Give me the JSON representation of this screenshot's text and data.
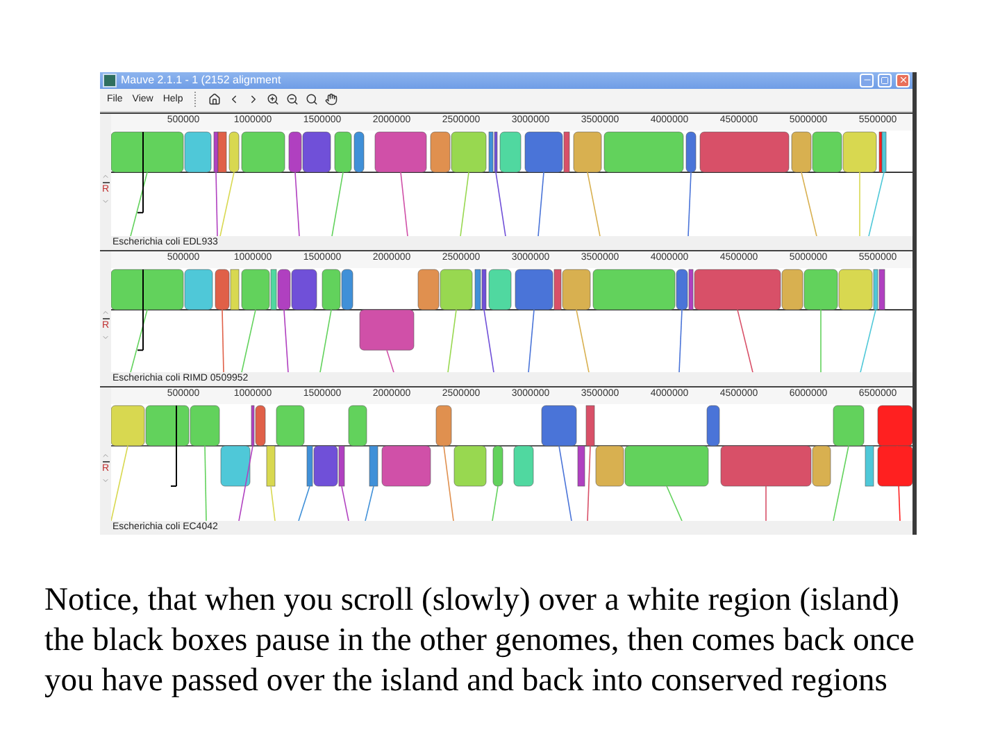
{
  "window": {
    "title": "Mauve 2.1.1 - 1 (2152 alignment"
  },
  "menu": [
    "File",
    "View",
    "Help"
  ],
  "genomes": [
    {
      "name": "Escherichia coli EDL933",
      "reverse_label": "R",
      "ticks": [
        "500000",
        "1000000",
        "1500000",
        "2000000",
        "2500000",
        "3000000",
        "3500000",
        "4000000",
        "4500000",
        "5000000",
        "5500000"
      ]
    },
    {
      "name": "Escherichia coli RIMD 0509952",
      "reverse_label": "R",
      "ticks": [
        "500000",
        "1000000",
        "1500000",
        "2000000",
        "2500000",
        "3000000",
        "3500000",
        "4000000",
        "4500000",
        "5000000",
        "5500000"
      ]
    },
    {
      "name": "Escherichia coli EC4042",
      "reverse_label": "R",
      "ticks": [
        "500000",
        "1000000",
        "1500000",
        "2000000",
        "2500000",
        "3000000",
        "3500000",
        "4000000",
        "4500000",
        "6000000",
        "6500000"
      ]
    }
  ],
  "caption": "Notice, that when you scroll (slowly) over a white region (island) the black boxes pause in the other genomes, then comes back once you have passed over the island and back into conserved regions"
}
